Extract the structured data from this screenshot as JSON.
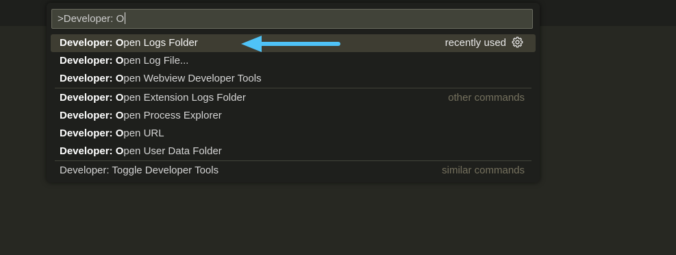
{
  "input": {
    "value": ">Developer: O"
  },
  "items": [
    {
      "prefix": "Developer: O",
      "rest": "pen Logs Folder",
      "label": "recently used",
      "icon": "gear-icon"
    },
    {
      "prefix": "Developer: O",
      "rest": "pen Log File..."
    },
    {
      "prefix": "Developer: O",
      "rest": "pen Webview Developer Tools"
    },
    {
      "prefix": "Developer: O",
      "rest": "pen Extension Logs Folder",
      "label": "other commands"
    },
    {
      "prefix": "Developer: O",
      "rest": "pen Process Explorer"
    },
    {
      "prefix": "Developer: O",
      "rest": "pen URL"
    },
    {
      "prefix": "Developer: O",
      "rest": "pen User Data Folder"
    },
    {
      "text": "Developer: Toggle Developer Tools",
      "label": "similar commands"
    }
  ],
  "colors": {
    "accent_arrow": "#4fc3f7",
    "background": "#272822",
    "selected_row": "#3e3d32"
  }
}
